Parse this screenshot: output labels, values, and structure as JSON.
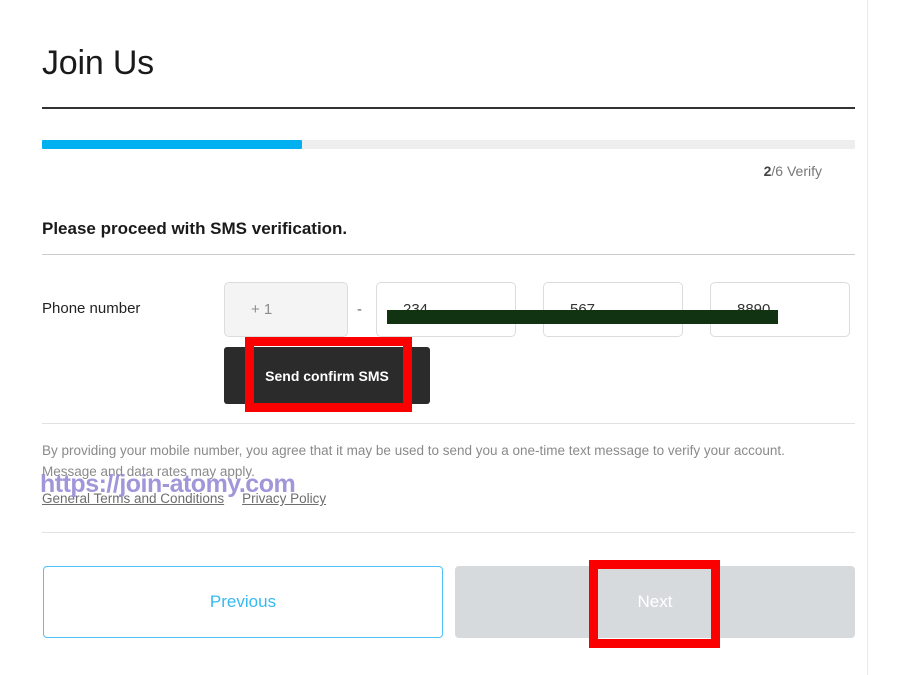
{
  "page": {
    "title": "Join Us"
  },
  "progress": {
    "percent": 32,
    "step_current": "2",
    "step_total_suffix": "/6 Verify",
    "fill_color": "#00b0f0",
    "track_color": "#eeeeee"
  },
  "section": {
    "heading": "Please proceed with SMS verification."
  },
  "phone": {
    "label": "Phone number",
    "country_code": "+ 1",
    "separator": "-",
    "part_1": "234",
    "part_2": "567",
    "part_3": "8890",
    "send_button_label": "Send confirm SMS",
    "redaction_color": "#113311"
  },
  "legal": {
    "text": "By providing your mobile number, you agree that it may be used to send you a one-time text message to verify your account. Message and data rates may apply.",
    "terms_link": "General Terms and Conditions",
    "privacy_link": "Privacy Policy"
  },
  "watermark": {
    "text": "https://join-atomy.com",
    "color": "#9a8ed6"
  },
  "nav": {
    "previous_label": "Previous",
    "next_label": "Next",
    "previous_color": "#35b9f2",
    "next_disabled_color": "#d6dadd"
  },
  "annotations": {
    "highlight_color": "#fb0000"
  }
}
